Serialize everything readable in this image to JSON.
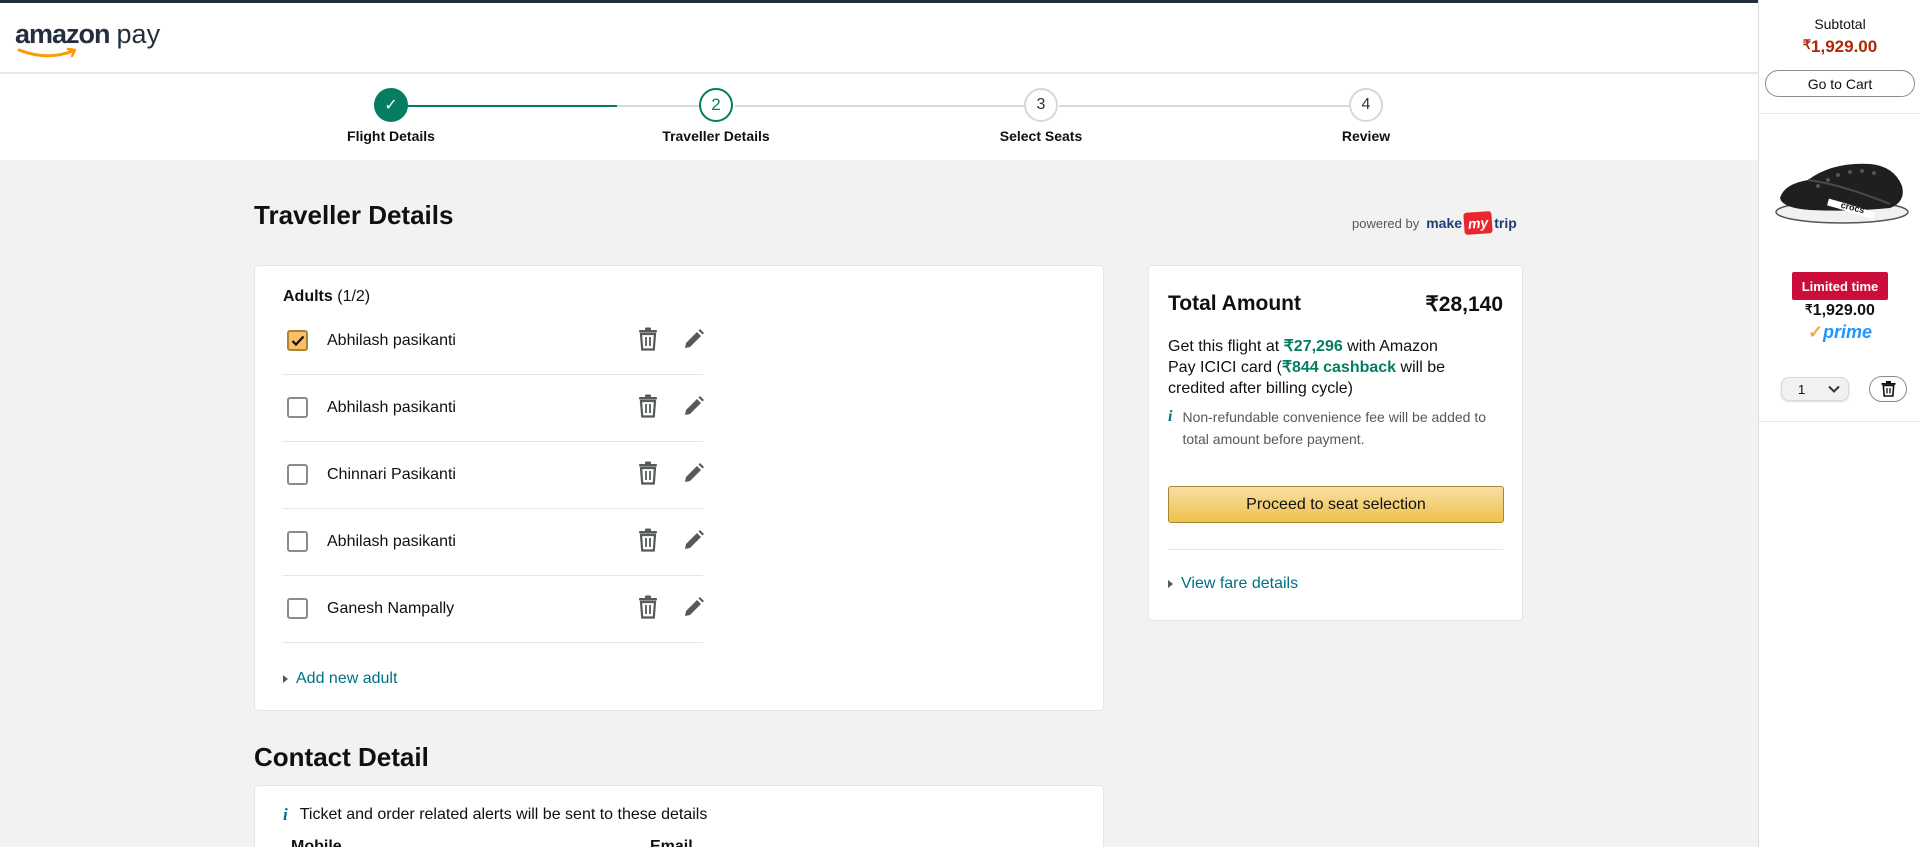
{
  "header": {
    "logo_amazon": "amazon",
    "logo_pay": "pay"
  },
  "stepper": {
    "steps": [
      {
        "number": "✓",
        "label": "Flight Details",
        "state": "done"
      },
      {
        "number": "2",
        "label": "Traveller Details",
        "state": "active"
      },
      {
        "number": "3",
        "label": "Select Seats",
        "state": "pending"
      },
      {
        "number": "4",
        "label": "Review",
        "state": "pending"
      }
    ]
  },
  "main": {
    "title": "Traveller Details",
    "powered_by": "powered by",
    "partner": {
      "make": "make",
      "my": "my",
      "trip": "trip"
    },
    "adults": {
      "label": "Adults",
      "count": "(1/2)",
      "travellers": [
        {
          "name": "Abhilash pasikanti",
          "checked": true
        },
        {
          "name": "Abhilash pasikanti",
          "checked": false
        },
        {
          "name": "Chinnari Pasikanti",
          "checked": false
        },
        {
          "name": "Abhilash pasikanti",
          "checked": false
        },
        {
          "name": "Ganesh Nampally",
          "checked": false
        }
      ],
      "add_link": "Add new adult"
    },
    "contact": {
      "title": "Contact Detail",
      "info": "Ticket and order related alerts will be sent to these details",
      "mobile_label": "Mobile",
      "email_label": "Email"
    }
  },
  "price": {
    "total_label": "Total Amount",
    "total_value": "₹28,140",
    "offer_prefix": "Get this flight at",
    "offer_price": "₹27,296",
    "offer_mid": "with Amazon Pay ICICI card (",
    "offer_cashback": "₹844 cashback",
    "offer_suffix": "will be credited after billing cycle)",
    "fee_note": "Non-refundable convenience fee will be added to total amount before payment.",
    "proceed_button": "Proceed to seat selection",
    "fare_link": "View fare details"
  },
  "cart_rail": {
    "subtotal_label": "Subtotal",
    "subtotal_currency": "₹",
    "subtotal_value": "1,929.00",
    "goto_button": "Go to Cart",
    "item": {
      "brand_on_strap": "crocs",
      "badge": "Limited time",
      "price_currency": "₹",
      "price_value": "1,929.00",
      "prime_text": "prime",
      "quantity": "1"
    }
  },
  "colors": {
    "accent_green": "#067d62",
    "link_blue": "#007185",
    "price_red": "#b12704",
    "badge_red": "#cc0c39",
    "button_yellow": "#f0c14b"
  }
}
